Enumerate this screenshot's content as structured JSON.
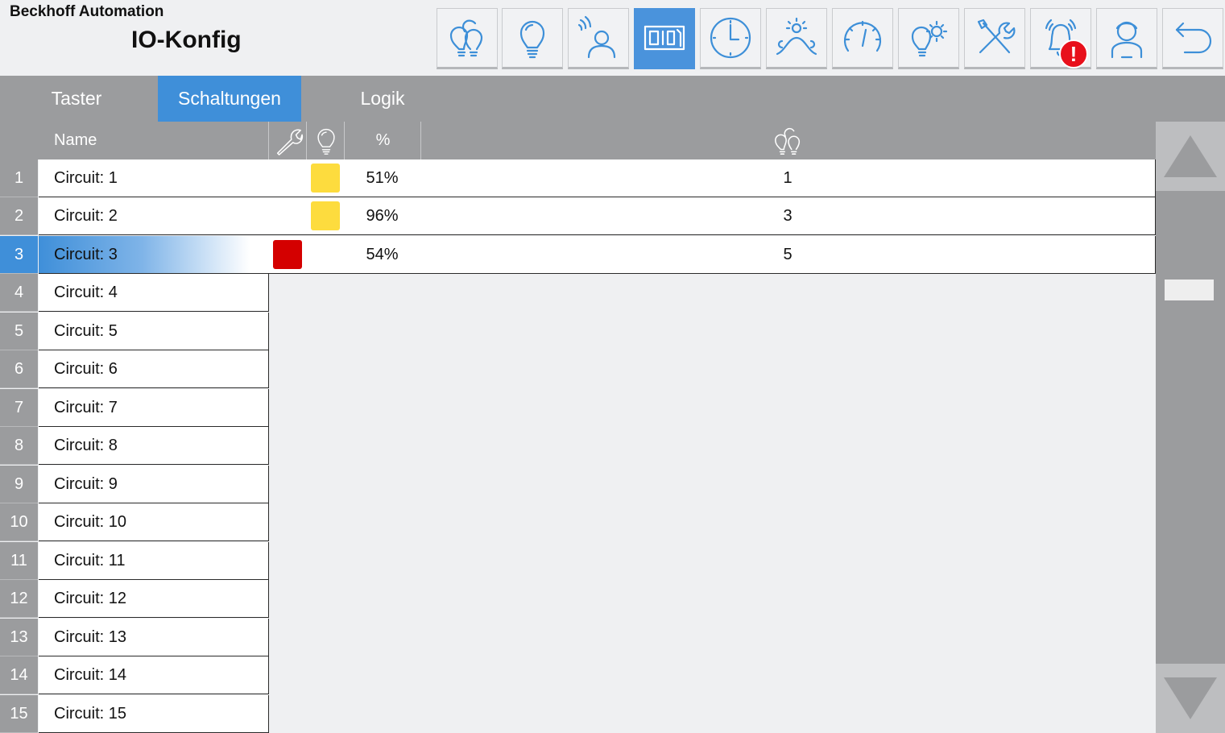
{
  "header": {
    "company": "Beckhoff Automation",
    "title": "IO-Konfig"
  },
  "toolbar": {
    "buttons": [
      {
        "icon": "bulb-group-icon",
        "active": false
      },
      {
        "icon": "lightbulb-icon",
        "active": false
      },
      {
        "icon": "presence-sensor-icon",
        "active": false
      },
      {
        "icon": "io-config-icon",
        "active": true
      },
      {
        "icon": "clock-icon",
        "active": false
      },
      {
        "icon": "daylight-icon",
        "active": false
      },
      {
        "icon": "gauge-icon",
        "active": false
      },
      {
        "icon": "bulb-gear-icon",
        "active": false
      },
      {
        "icon": "tools-icon",
        "active": false
      },
      {
        "icon": "alarm-bell-icon",
        "active": false
      },
      {
        "icon": "user-icon",
        "active": false
      },
      {
        "icon": "back-icon",
        "active": false
      }
    ],
    "alarm_badge": "!"
  },
  "tabs": [
    {
      "label": "Taster",
      "active": false
    },
    {
      "label": "Schaltungen",
      "active": true
    },
    {
      "label": "Logik",
      "active": false
    }
  ],
  "table": {
    "headers": {
      "name": "Name",
      "percent": "%"
    },
    "rows": [
      {
        "num": "1",
        "name": "Circuit: 1",
        "config": "",
        "state": "#fddc3e",
        "percent": "51%",
        "group": "1"
      },
      {
        "num": "2",
        "name": "Circuit: 2",
        "config": "",
        "state": "#fddc3e",
        "percent": "96%",
        "group": "3"
      },
      {
        "num": "3",
        "name": "Circuit: 3",
        "config": "#d40000",
        "state": "",
        "percent": "54%",
        "group": "5",
        "selected": true
      },
      {
        "num": "4",
        "name": "Circuit: 4"
      },
      {
        "num": "5",
        "name": "Circuit: 5"
      },
      {
        "num": "6",
        "name": "Circuit: 6"
      },
      {
        "num": "7",
        "name": "Circuit: 7"
      },
      {
        "num": "8",
        "name": "Circuit: 8"
      },
      {
        "num": "9",
        "name": "Circuit: 9"
      },
      {
        "num": "10",
        "name": "Circuit: 10"
      },
      {
        "num": "11",
        "name": "Circuit: 11"
      },
      {
        "num": "12",
        "name": "Circuit: 12"
      },
      {
        "num": "13",
        "name": "Circuit: 13"
      },
      {
        "num": "14",
        "name": "Circuit: 14"
      },
      {
        "num": "15",
        "name": "Circuit: 15"
      }
    ]
  },
  "colors": {
    "accent": "#3f8fd9",
    "state_on": "#fddc3e",
    "config_error": "#d40000",
    "alarm": "#e8101b"
  }
}
